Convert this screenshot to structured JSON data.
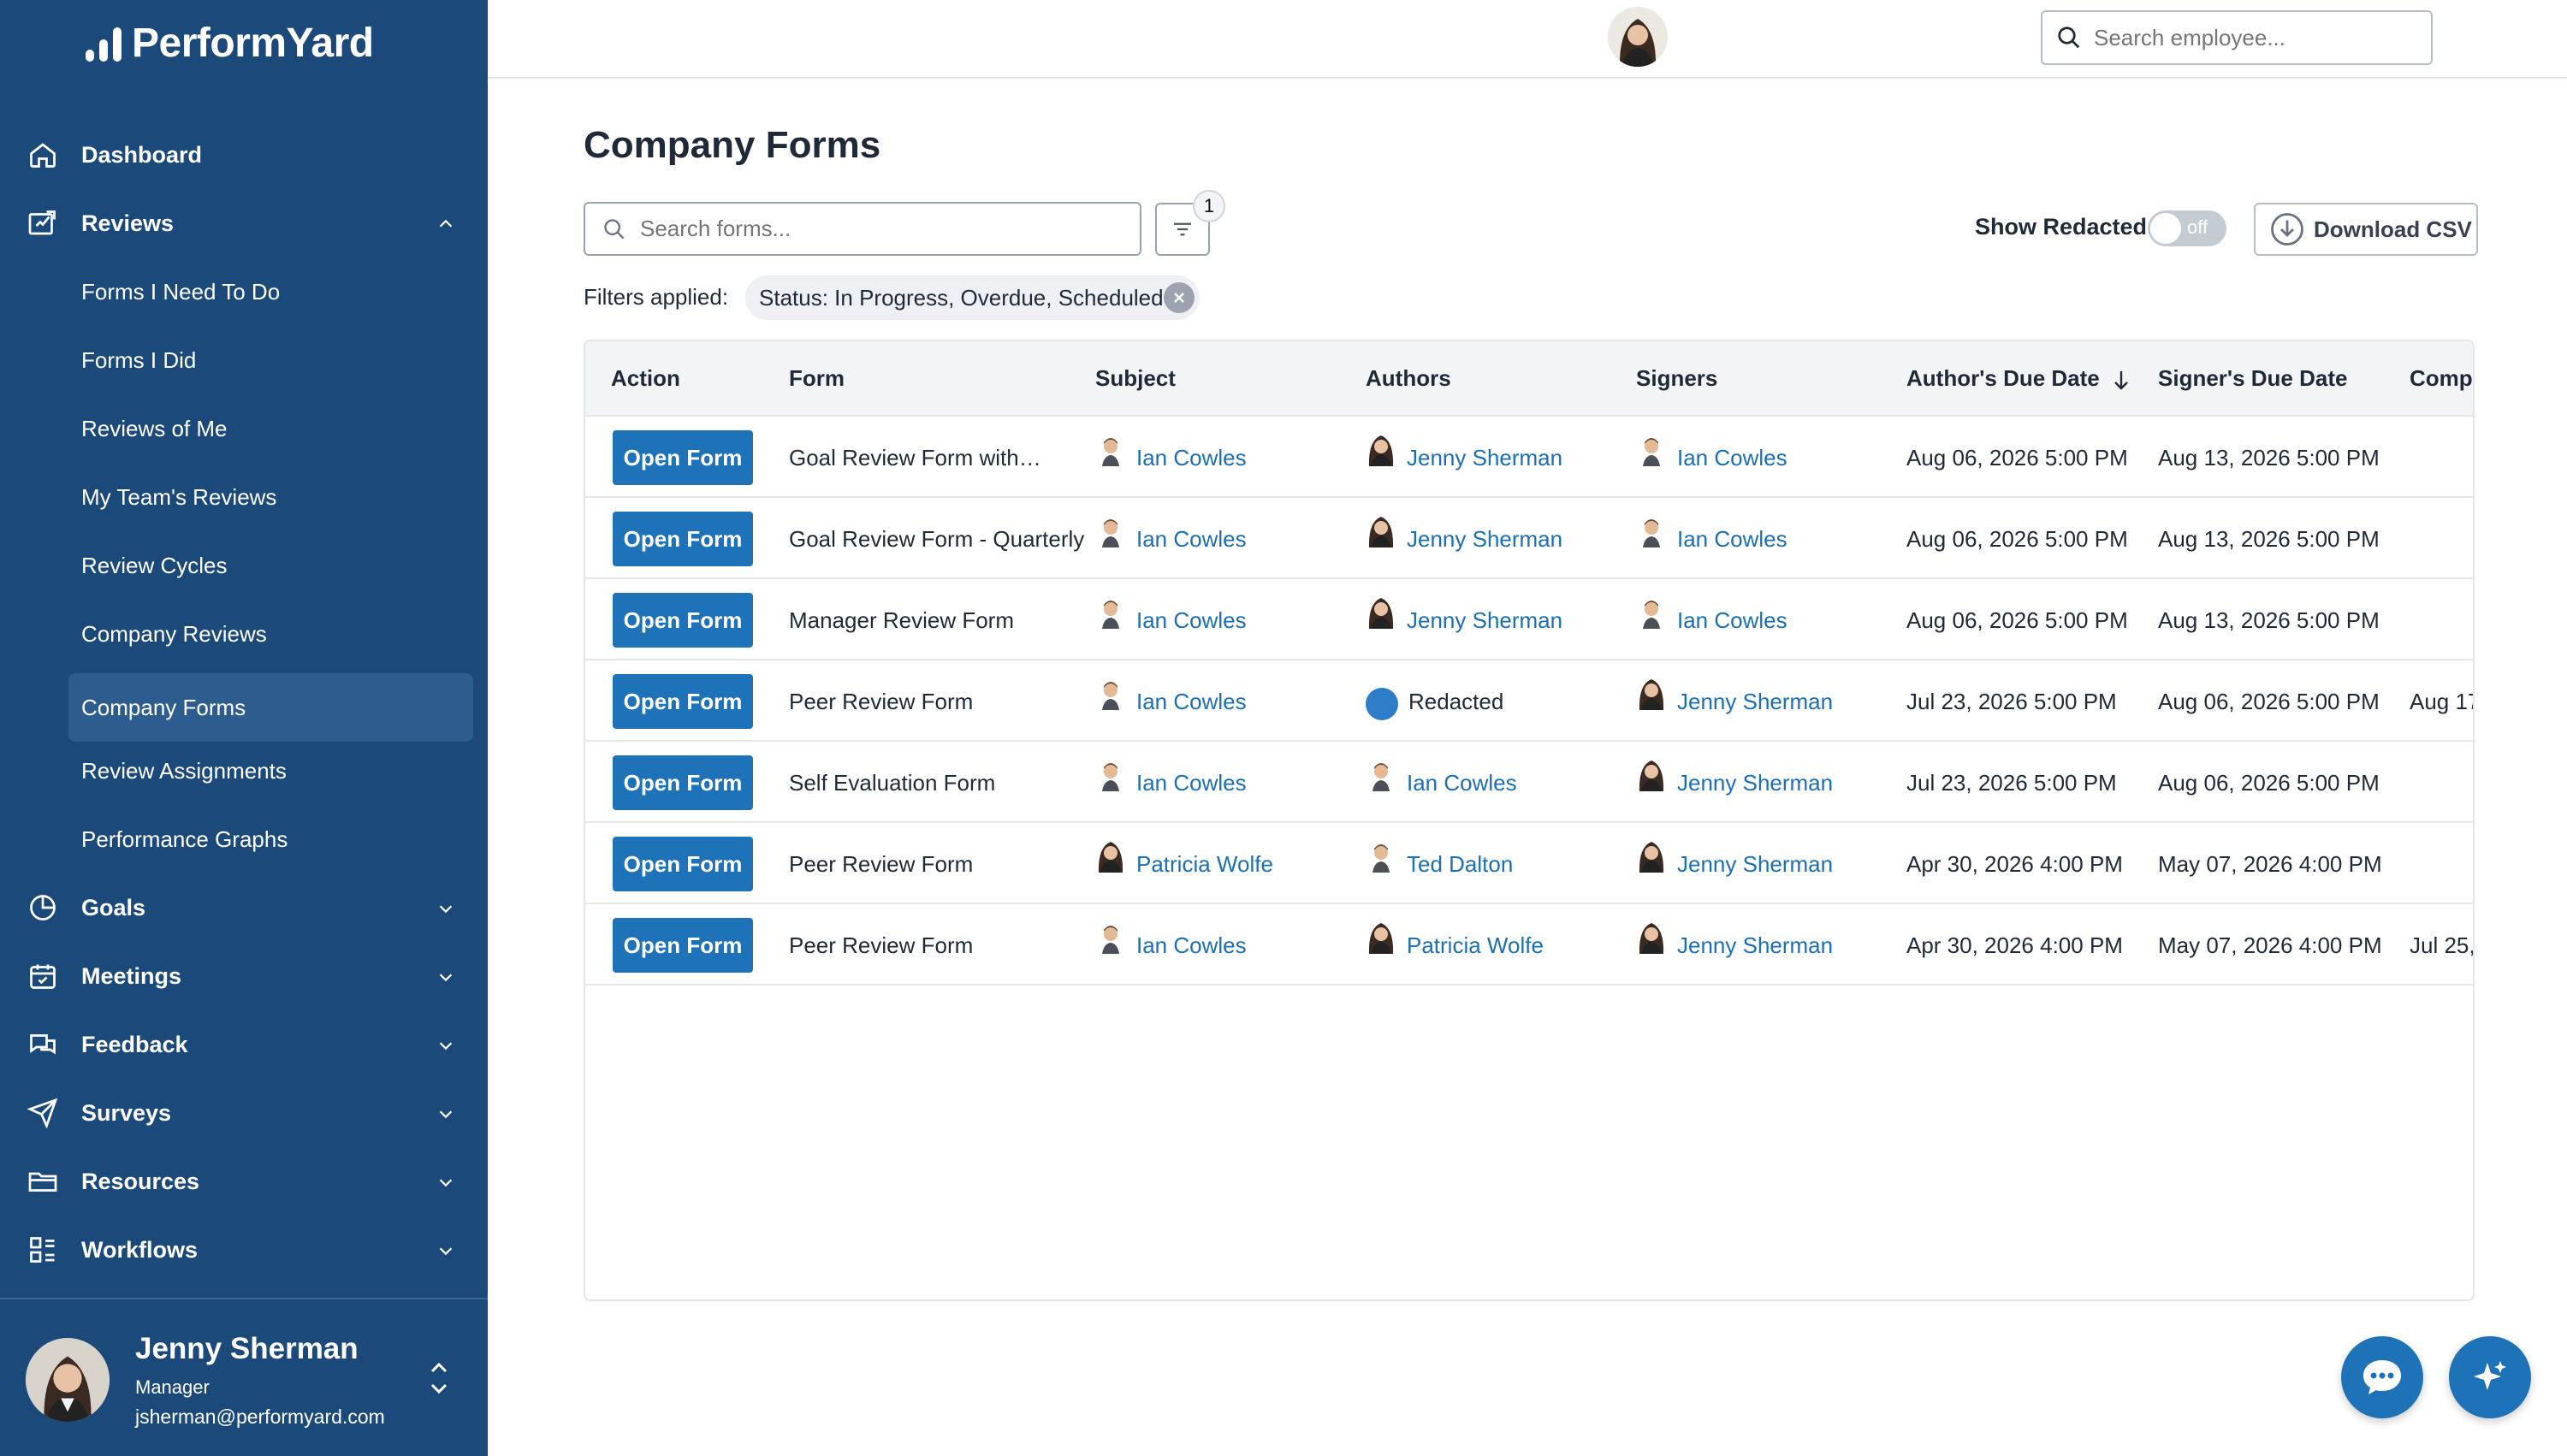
{
  "brand": {
    "name": "PerformYard"
  },
  "sidebar": {
    "dashboard": "Dashboard",
    "reviews": "Reviews",
    "review_items": [
      "Forms I Need To Do",
      "Forms I Did",
      "Reviews of Me",
      "My Team's Reviews",
      "Review Cycles",
      "Company Reviews",
      "Company Forms",
      "Review Assignments",
      "Performance Graphs"
    ],
    "active_item": "Company Forms",
    "sections": [
      "Goals",
      "Meetings",
      "Feedback",
      "Surveys",
      "Resources",
      "Workflows"
    ]
  },
  "user": {
    "name": "Jenny Sherman",
    "role": "Manager",
    "email": "jsherman@performyard.com"
  },
  "topbar": {
    "employee_search_placeholder": "Search employee..."
  },
  "page": {
    "title": "Company Forms",
    "search_placeholder": "Search forms...",
    "filter_count": "1",
    "show_redacted_label": "Show Redacted",
    "toggle_state": "off",
    "download_csv": "Download CSV",
    "filters_applied_label": "Filters applied:",
    "filter_chip": "Status: In Progress, Overdue, Scheduled"
  },
  "table": {
    "headers": [
      "Action",
      "Form",
      "Subject",
      "Authors",
      "Signers",
      "Author's Due Date",
      "Signer's Due Date",
      "Compl"
    ],
    "action_label": "Open Form",
    "rows": [
      {
        "form": "Goal Review Form with…",
        "subject": "Ian Cowles",
        "author": "Jenny Sherman",
        "signer": "Ian Cowles",
        "author_due": "Aug 06, 2026 5:00 PM",
        "signer_due": "Aug 13, 2026 5:00 PM",
        "completed": ""
      },
      {
        "form": "Goal Review Form - Quarterly",
        "subject": "Ian Cowles",
        "author": "Jenny Sherman",
        "signer": "Ian Cowles",
        "author_due": "Aug 06, 2026 5:00 PM",
        "signer_due": "Aug 13, 2026 5:00 PM",
        "completed": ""
      },
      {
        "form": "Manager Review Form",
        "subject": "Ian Cowles",
        "author": "Jenny Sherman",
        "signer": "Ian Cowles",
        "author_due": "Aug 06, 2026 5:00 PM",
        "signer_due": "Aug 13, 2026 5:00 PM",
        "completed": ""
      },
      {
        "form": "Peer Review Form",
        "subject": "Ian Cowles",
        "author": "Redacted",
        "signer": "Jenny Sherman",
        "author_due": "Jul 23, 2026 5:00 PM",
        "signer_due": "Aug 06, 2026 5:00 PM",
        "completed": "Aug 17"
      },
      {
        "form": "Self Evaluation Form",
        "subject": "Ian Cowles",
        "author": "Ian Cowles",
        "signer": "Jenny Sherman",
        "author_due": "Jul 23, 2026 5:00 PM",
        "signer_due": "Aug 06, 2026 5:00 PM",
        "completed": ""
      },
      {
        "form": "Peer Review Form",
        "subject": "Patricia Wolfe",
        "author": "Ted Dalton",
        "signer": "Jenny Sherman",
        "author_due": "Apr 30, 2026 4:00 PM",
        "signer_due": "May 07, 2026 4:00 PM",
        "completed": ""
      },
      {
        "form": "Peer Review Form",
        "subject": "Ian Cowles",
        "author": "Patricia Wolfe",
        "signer": "Jenny Sherman",
        "author_due": "Apr 30, 2026 4:00 PM",
        "signer_due": "May 07, 2026 4:00 PM",
        "completed": "Jul 25,"
      }
    ]
  },
  "colors": {
    "sidebar_bg": "#1b4a7a",
    "sidebar_active": "#2d5d8e",
    "primary_button": "#1e73b8",
    "link": "#1a6fb5",
    "redacted_dot": "#2e7dc9"
  },
  "icons": [
    "home-icon",
    "reviews-icon",
    "goals-icon",
    "meetings-icon",
    "feedback-icon",
    "surveys-icon",
    "resources-icon",
    "workflows-icon",
    "search-icon",
    "filter-icon",
    "download-icon",
    "sort-down-icon",
    "chat-icon",
    "sparkle-icon"
  ]
}
